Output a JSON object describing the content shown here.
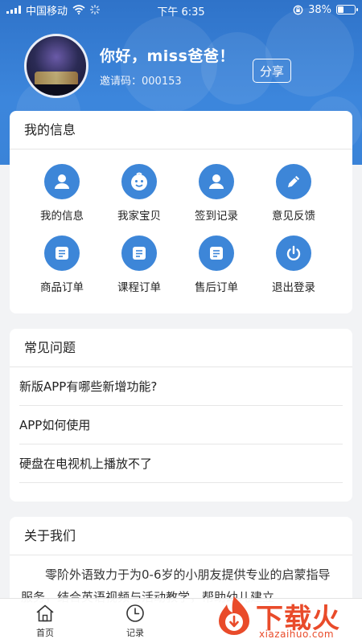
{
  "status_bar": {
    "carrier": "中国移动",
    "time": "下午 6:35",
    "battery_percent": "38%",
    "battery_level": 0.38
  },
  "profile": {
    "greeting": "你好，miss爸爸！",
    "invite_label": "邀请码：",
    "invite_code": "000153",
    "share_label": "分享"
  },
  "my_info": {
    "title": "我的信息",
    "items": [
      {
        "label": "我的信息",
        "icon": "person-icon"
      },
      {
        "label": "我家宝贝",
        "icon": "baby-face-icon"
      },
      {
        "label": "签到记录",
        "icon": "person-icon"
      },
      {
        "label": "意见反馈",
        "icon": "pencil-icon"
      },
      {
        "label": "商品订单",
        "icon": "document-icon"
      },
      {
        "label": "课程订单",
        "icon": "document-icon"
      },
      {
        "label": "售后订单",
        "icon": "document-icon"
      },
      {
        "label": "退出登录",
        "icon": "power-icon"
      }
    ]
  },
  "faq": {
    "title": "常见问题",
    "items": [
      "新版APP有哪些新增功能?",
      "APP如何使用",
      "硬盘在电视机上播放不了"
    ]
  },
  "about": {
    "title": "关于我们",
    "text": "零阶外语致力于为0-6岁的小朋友提供专业的启蒙指导服务，结合英语视频与活动教学，帮助幼儿建立"
  },
  "tabbar": {
    "tabs": [
      {
        "label": "首页",
        "icon": "home-icon"
      },
      {
        "label": "记录",
        "icon": "clock-icon"
      }
    ]
  },
  "watermark": {
    "text": "下载火",
    "url": "xiazaihuo.com"
  },
  "colors": {
    "header_blue": "#3a83d8",
    "icon_blue": "#3d86d8",
    "watermark_red": "#e94b2a"
  }
}
